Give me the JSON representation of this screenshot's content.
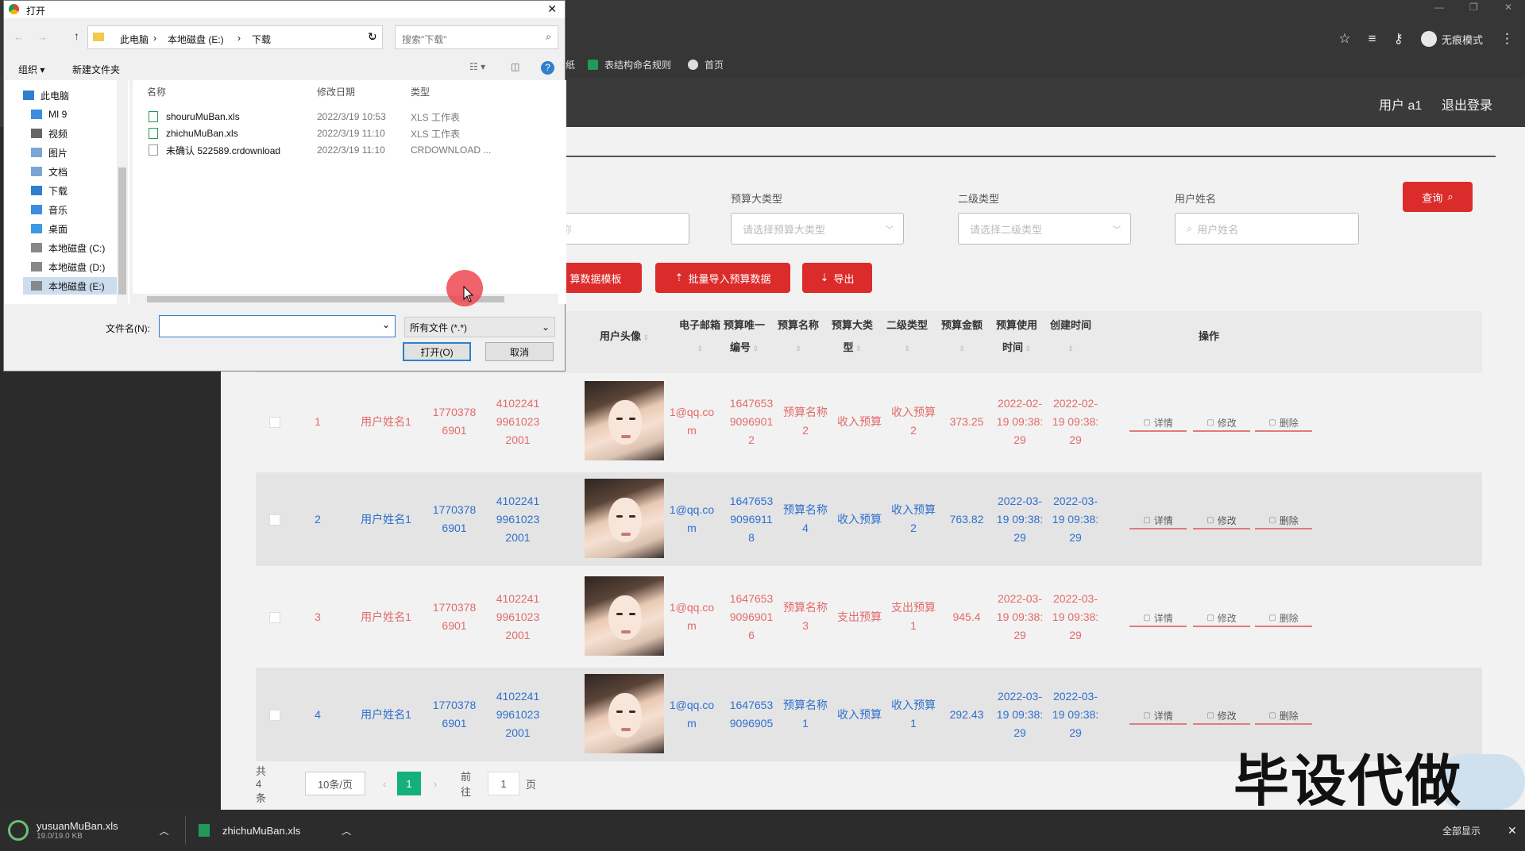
{
  "browser": {
    "incognito_label": "无痕模式",
    "bookmarks": [
      "纸",
      "表结构命名规则",
      "首页"
    ]
  },
  "topnav": {
    "user": "用户 a1",
    "logout": "退出登录"
  },
  "filters": {
    "labels": [
      "预算大类型",
      "二级类型",
      "用户姓名"
    ],
    "placeholders": [
      "请选择预算大类型",
      "请选择二级类型",
      "用户姓名"
    ],
    "first_partial": "称"
  },
  "buttons": {
    "query": "查询",
    "template": "算数据模板",
    "batch_import": "批量导入预算数据",
    "export": "导出"
  },
  "table": {
    "headers": [
      "用户头像",
      "电子邮箱",
      "预算唯一编号",
      "预算名称",
      "预算大类型",
      "二级类型",
      "预算金额",
      "预算使用时间",
      "创建时间",
      "操作"
    ],
    "header_lines": [
      [
        "用户头像"
      ],
      [
        "电子邮箱"
      ],
      [
        "预算唯一",
        "编号"
      ],
      [
        "预算名称"
      ],
      [
        "预算大类",
        "型"
      ],
      [
        "二级类型"
      ],
      [
        "预算金额"
      ],
      [
        "预算使用",
        "时间"
      ],
      [
        "创建时间"
      ],
      [
        "操作"
      ]
    ],
    "rows": [
      {
        "idx": "1",
        "name": "用户姓名1",
        "phone": [
          "1770378",
          "6901"
        ],
        "idcard": [
          "4102241",
          "9961023",
          "2001"
        ],
        "email": [
          "1@qq.co",
          "m"
        ],
        "code": [
          "1647653",
          "9096901",
          "2"
        ],
        "bname": [
          "预算名称",
          "2"
        ],
        "btype": "收入预算",
        "sub": [
          "收入预算",
          "2"
        ],
        "amount": "373.25",
        "usetime": [
          "2022-02-",
          "19 09:38:",
          "29"
        ],
        "ctime": [
          "2022-02-",
          "19 09:38:",
          "29"
        ]
      },
      {
        "idx": "2",
        "name": "用户姓名1",
        "phone": [
          "1770378",
          "6901"
        ],
        "idcard": [
          "4102241",
          "9961023",
          "2001"
        ],
        "email": [
          "1@qq.co",
          "m"
        ],
        "code": [
          "1647653",
          "9096911",
          "8"
        ],
        "bname": [
          "预算名称",
          "4"
        ],
        "btype": "收入预算",
        "sub": [
          "收入预算",
          "2"
        ],
        "amount": "763.82",
        "usetime": [
          "2022-03-",
          "19 09:38:",
          "29"
        ],
        "ctime": [
          "2022-03-",
          "19 09:38:",
          "29"
        ]
      },
      {
        "idx": "3",
        "name": "用户姓名1",
        "phone": [
          "1770378",
          "6901"
        ],
        "idcard": [
          "4102241",
          "9961023",
          "2001"
        ],
        "email": [
          "1@qq.co",
          "m"
        ],
        "code": [
          "1647653",
          "9096901",
          "6"
        ],
        "bname": [
          "预算名称",
          "3"
        ],
        "btype": "支出预算",
        "sub": [
          "支出预算",
          "1"
        ],
        "amount": "945.4",
        "usetime": [
          "2022-03-",
          "19 09:38:",
          "29"
        ],
        "ctime": [
          "2022-03-",
          "19 09:38:",
          "29"
        ]
      },
      {
        "idx": "4",
        "name": "用户姓名1",
        "phone": [
          "1770378",
          "6901"
        ],
        "idcard": [
          "4102241",
          "9961023",
          "2001"
        ],
        "email": [
          "1@qq.co",
          "m"
        ],
        "code": [
          "1647653",
          "9096905",
          ""
        ],
        "bname": [
          "预算名称",
          "1"
        ],
        "btype": "收入预算",
        "sub": [
          "收入预算",
          "1"
        ],
        "amount": "292.43",
        "usetime": [
          "2022-03-",
          "19 09:38:",
          "29"
        ],
        "ctime": [
          "2022-03-",
          "19 09:38:",
          "29"
        ]
      }
    ],
    "actions": [
      "详情",
      "修改",
      "删除"
    ]
  },
  "pager": {
    "total": "共 4 条",
    "size": "10条/页",
    "page": "1",
    "goto": "前往",
    "goto_val": "1",
    "page_suffix": "页"
  },
  "dialog": {
    "title": "打开",
    "breadcrumb": [
      "此电脑",
      "本地磁盘 (E:)",
      "下载"
    ],
    "search_placeholder": "搜索\"下载\"",
    "organize": "组织",
    "new_folder": "新建文件夹",
    "nav": [
      "此电脑",
      "MI 9",
      "视频",
      "图片",
      "文档",
      "下载",
      "音乐",
      "桌面",
      "本地磁盘 (C:)",
      "本地磁盘 (D:)",
      "本地磁盘 (E:)"
    ],
    "columns": [
      "名称",
      "修改日期",
      "类型"
    ],
    "files": [
      {
        "name": "shouruMuBan.xls",
        "date": "2022/3/19 10:53",
        "type": "XLS 工作表"
      },
      {
        "name": "zhichuMuBan.xls",
        "date": "2022/3/19 11:10",
        "type": "XLS 工作表"
      },
      {
        "name": "未确认 522589.crdownload",
        "date": "2022/3/19 11:10",
        "type": "CRDOWNLOAD ..."
      }
    ],
    "filename_label": "文件名(N):",
    "filetype": "所有文件 (*.*)",
    "open": "打开(O)",
    "cancel": "取消"
  },
  "downloads": [
    {
      "name": "yusuanMuBan.xls",
      "size": "19.0/19.0 KB"
    },
    {
      "name": "zhichuMuBan.xls"
    }
  ],
  "show_all": "全部显示",
  "watermark": "毕设代做",
  "colors": {
    "red": "#dc2b2b",
    "pink_text": "#e36a6a",
    "blue_text": "#2f6fcf",
    "green_page": "#13b07c"
  }
}
